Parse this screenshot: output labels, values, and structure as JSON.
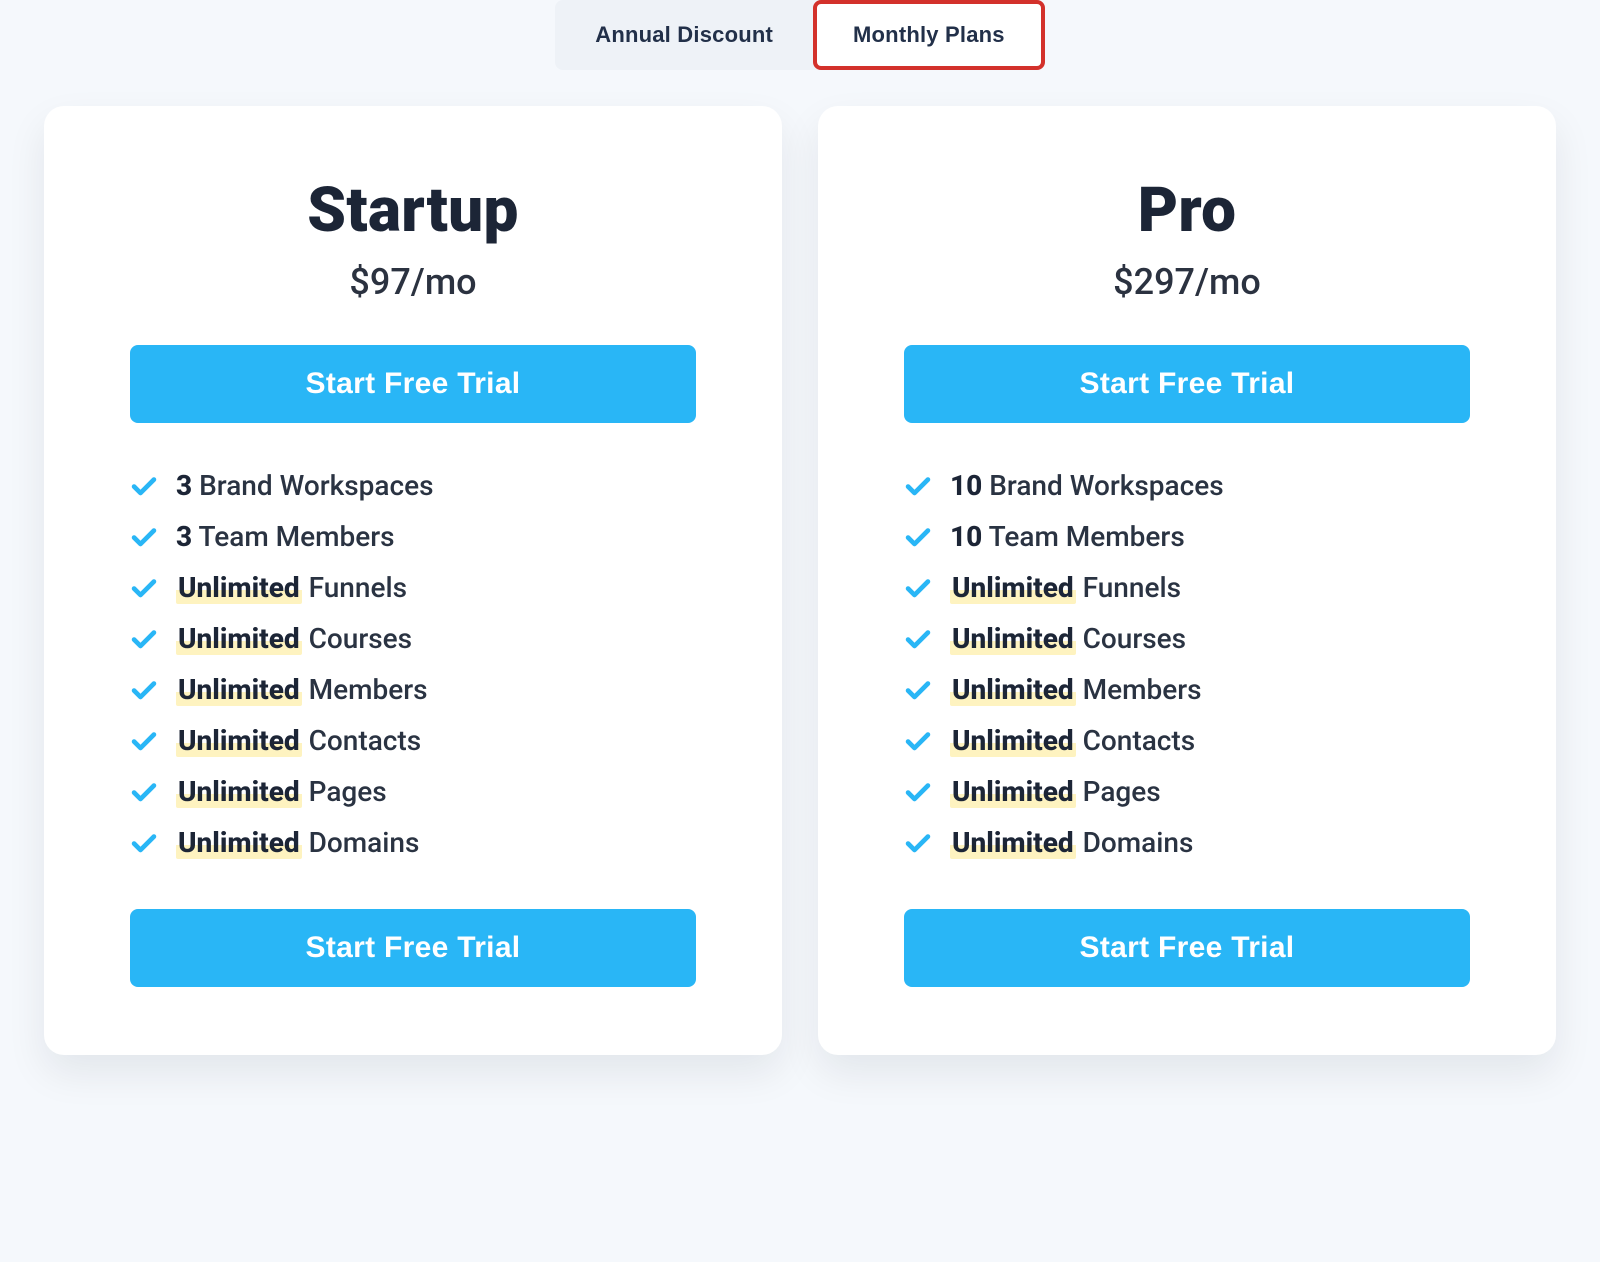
{
  "colors": {
    "accent": "#29b6f6",
    "highlight": "#fef3c0",
    "tab_highlight_border": "#d3312b"
  },
  "toggle": {
    "annual_label": "Annual Discount",
    "monthly_label": "Monthly Plans",
    "active": "monthly"
  },
  "plans": [
    {
      "id": "startup",
      "title": "Startup",
      "price": "$97/mo",
      "cta_top": "Start Free Trial",
      "cta_bottom": "Start Free Trial",
      "features": [
        {
          "bold": "3",
          "highlight": false,
          "rest": " Brand Workspaces"
        },
        {
          "bold": "3",
          "highlight": false,
          "rest": " Team Members"
        },
        {
          "bold": "Unlimited",
          "highlight": true,
          "rest": " Funnels"
        },
        {
          "bold": "Unlimited",
          "highlight": true,
          "rest": " Courses"
        },
        {
          "bold": "Unlimited",
          "highlight": true,
          "rest": " Members"
        },
        {
          "bold": "Unlimited",
          "highlight": true,
          "rest": " Contacts"
        },
        {
          "bold": "Unlimited",
          "highlight": true,
          "rest": " Pages"
        },
        {
          "bold": "Unlimited",
          "highlight": true,
          "rest": " Domains"
        }
      ]
    },
    {
      "id": "pro",
      "title": "Pro",
      "price": "$297/mo",
      "cta_top": "Start Free Trial",
      "cta_bottom": "Start Free Trial",
      "features": [
        {
          "bold": "10",
          "highlight": false,
          "rest": " Brand Workspaces"
        },
        {
          "bold": "10",
          "highlight": false,
          "rest": " Team Members"
        },
        {
          "bold": "Unlimited",
          "highlight": true,
          "rest": " Funnels"
        },
        {
          "bold": "Unlimited",
          "highlight": true,
          "rest": " Courses"
        },
        {
          "bold": "Unlimited",
          "highlight": true,
          "rest": " Members"
        },
        {
          "bold": "Unlimited",
          "highlight": true,
          "rest": " Contacts"
        },
        {
          "bold": "Unlimited",
          "highlight": true,
          "rest": " Pages"
        },
        {
          "bold": "Unlimited",
          "highlight": true,
          "rest": " Domains"
        }
      ]
    }
  ]
}
